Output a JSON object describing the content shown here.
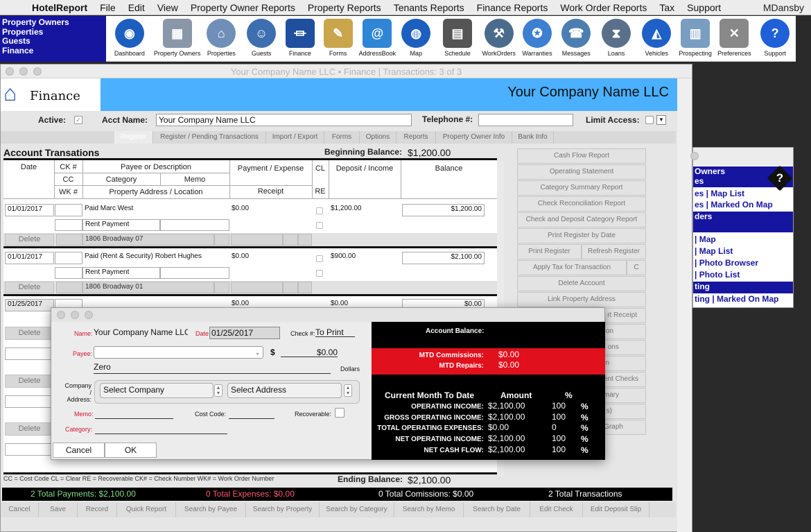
{
  "menubar": {
    "apple": "",
    "app_name": "HotelReport",
    "items": [
      "File",
      "Edit",
      "View",
      "Property Owner Reports",
      "Property Reports",
      "Tenants Reports",
      "Finance Reports",
      "Work Order Reports",
      "Tax",
      "Support"
    ],
    "user": "MDansby"
  },
  "toolbar_left": [
    "Property Owners",
    "Properties",
    "Guests",
    "Finance"
  ],
  "toolbar": [
    {
      "label": "Dashboard",
      "icon": "globe-icon",
      "color": "#1d5fbf"
    },
    {
      "label": "Property Owners",
      "icon": "building-icon",
      "color": "#8a97a8"
    },
    {
      "label": "Properties",
      "icon": "house-icon",
      "color": "#6f8fb8"
    },
    {
      "label": "Guests",
      "icon": "people-icon",
      "color": "#3d6fb0"
    },
    {
      "label": "Finance",
      "icon": "bank-icon",
      "color": "#1f4f9e"
    },
    {
      "label": "Forms",
      "icon": "form-icon",
      "color": "#c9a64b"
    },
    {
      "label": "AddressBook",
      "icon": "addressbook-icon",
      "color": "#2f86d6"
    },
    {
      "label": "Map",
      "icon": "map-globe-icon",
      "color": "#1d5fbf"
    },
    {
      "label": "Schedule",
      "icon": "calendar-icon",
      "color": "#555555"
    },
    {
      "label": "WorkOrders",
      "icon": "tools-icon",
      "color": "#4a6b8c"
    },
    {
      "label": "Warranties",
      "icon": "warranty-badge-icon",
      "color": "#3d7fd0"
    },
    {
      "label": "Messages",
      "icon": "telephone-icon",
      "color": "#4c7fb0"
    },
    {
      "label": "Loans",
      "icon": "hourglass-icon",
      "color": "#5a6f8a"
    },
    {
      "label": "Vehicles",
      "icon": "car-icon",
      "color": "#1f5fc8"
    },
    {
      "label": "Prospecting",
      "icon": "skyscraper-icon",
      "color": "#7a9ec2"
    },
    {
      "label": "Preferences",
      "icon": "wrench-icon",
      "color": "#888888"
    },
    {
      "label": "Support",
      "icon": "help-icon",
      "color": "#1f5fd8"
    }
  ],
  "window": {
    "title": "Your Company Name LLC  •  Finance | Transactions: 3 of 3"
  },
  "header": {
    "module": "Finance",
    "company": "Your Company Name LLC"
  },
  "account": {
    "active_label": "Active:",
    "acct_name_label": "Acct Name:",
    "acct_name": "Your Company Name LLC",
    "telephone_label": "Telephone #:",
    "telephone": "",
    "limit_access_label": "Limit Access:"
  },
  "tabs": [
    "Register",
    "Register / Pending Transactions",
    "Import / Export",
    "Forms",
    "Options",
    "Reports",
    "Property Owner Info",
    "Bank Info"
  ],
  "register": {
    "title": "Account Transations",
    "beginning_balance_label": "Beginning Balance:",
    "beginning_balance": "$1,200.00",
    "headers": {
      "date": "Date",
      "ck": "CK #",
      "cc": "CC",
      "wk": "WK #",
      "payee": "Payee or Description",
      "category": "Category",
      "memo": "Memo",
      "address": "Property Address / Location",
      "payment": "Payment / Expense",
      "receipt": "Receipt",
      "cl": "CL",
      "re": "RE",
      "deposit": "Deposit / Income",
      "balance": "Balance"
    },
    "rows": [
      {
        "date": "01/01/2017",
        "payee": "Paid Marc West",
        "category": "Rent Payment",
        "address": "1806 Broadway 07",
        "payment": "$0.00",
        "deposit": "$1,200.00",
        "balance": "$1,200.00",
        "delete": "Delete"
      },
      {
        "date": "01/01/2017",
        "payee": "Paid (Rent & Security) Robert Hughes",
        "category": "Rent Payment",
        "address": "1806 Broadway 01",
        "payment": "$0.00",
        "deposit": "$900.00",
        "balance": "$2,100.00",
        "delete": "Delete"
      },
      {
        "date": "01/25/2017",
        "payee": "",
        "category": "",
        "address": "",
        "payment": "$0.00",
        "deposit": "$0.00",
        "balance": "$0.00",
        "delete": "Delete"
      }
    ],
    "extra_deletes": [
      "Delete",
      "Delete",
      "Delete"
    ],
    "legend": "CC = Cost Code   CL = Clear   RE = Recoverable   CK# = Check Number   WK# = Work Order Number",
    "ending_balance_label": "Ending Balance:",
    "ending_balance": "$2,100.00"
  },
  "right_buttons": [
    "Cash Flow Report",
    "Operating Statement",
    "Category Summary Report",
    "Check Reconciliation Report",
    "Check and Deposit Category Report",
    "Print Register by Date"
  ],
  "right_pair": [
    "Print Register",
    "Refresh Register"
  ],
  "right_tax": [
    "Apply Tax for Transaction",
    "C"
  ],
  "right_buttons2": [
    "Delete Account",
    "Link Property Address"
  ],
  "right_partial": [
    "rt Receipt",
    "on",
    "ons",
    "n",
    "ent Checks",
    "mary",
    "s)",
    "Graph"
  ],
  "totals": {
    "payments": "2 Total Payments: $2,100.00",
    "expenses": "0 Total Expenses: $0.00",
    "commissions": "0 Total Comissions: $0.00",
    "transactions": "2 Total Transactions"
  },
  "bottom_buttons": [
    "Cancel",
    "Save",
    "Record",
    "Quick Report",
    "Search by Payee",
    "Search by Property",
    "Search by Category",
    "Search by Memo",
    "Search by Date",
    "Edit Check",
    "Edit Deposit Slip"
  ],
  "side_window": {
    "rows": [
      " Owners",
      "es",
      "es | Map List",
      "es | Marked On Map",
      "ders",
      " | Map",
      " | Map List",
      " | Photo Browser",
      " | Photo List",
      "ting",
      "ting | Marked On Map"
    ]
  },
  "dialog": {
    "name_label": "Name:",
    "name": "Your Company Name LLC",
    "date_label": "Date",
    "date": "01/25/2017",
    "check_label": "Check #:",
    "check": "To Print",
    "payee_label": "Payee:",
    "payee": "",
    "dollar_sign": "$",
    "amount": "$0.00",
    "amount_words": "Zero",
    "dollars_label": "Dollars",
    "company_label": "Company /",
    "address_label": "Address:",
    "company_select": "Select Company",
    "address_select": "Select Address",
    "memo_label": "Memo:",
    "cost_code_label": "Cost Code:",
    "recoverable_label": "Recoverable:",
    "category_label": "Category:",
    "cancel": "Cancel",
    "ok": "OK",
    "account_balance_label": "Account Balance:",
    "mtd_commissions_label": "MTD Commissions:",
    "mtd_commissions": "$0.00",
    "mtd_repairs_label": "MTD Repairs:",
    "mtd_repairs": "$0.00",
    "cmtd_label": "Current Month To Date",
    "amount_header": "Amount",
    "pct_header": "%",
    "summary": [
      {
        "label": "OPERATING INCOME:",
        "amount": "$2,100.00",
        "pct": "100",
        "sym": "%"
      },
      {
        "label": "GROSS OPERATING INCOME:",
        "amount": "$2,100.00",
        "pct": "100",
        "sym": "%"
      },
      {
        "label": "TOTAL OPERATING EXPENSES:",
        "amount": "$0.00",
        "pct": "0",
        "sym": "%"
      },
      {
        "label": "NET OPERATING INCOME:",
        "amount": "$2,100.00",
        "pct": "100",
        "sym": "%"
      },
      {
        "label": "NET CASH FLOW:",
        "amount": "$2,100.00",
        "pct": "100",
        "sym": "%"
      }
    ]
  }
}
